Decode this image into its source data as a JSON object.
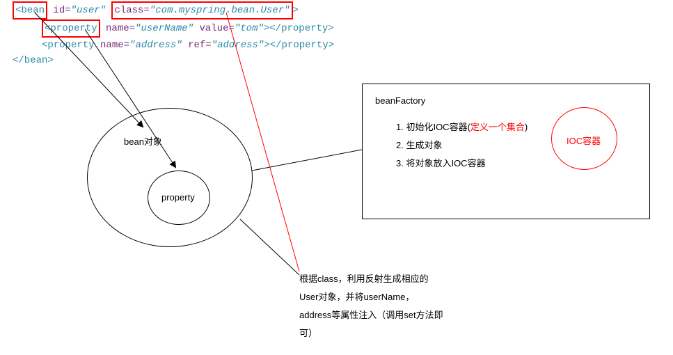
{
  "code": {
    "line1": {
      "open": "<bean",
      "attr_id": " id=",
      "val_id": "\"user\"",
      "attr_class": " class=",
      "val_class": "\"com.myspring.bean.User\"",
      "close": ">"
    },
    "line2": {
      "open": "<property",
      "attr_name": " name=",
      "val_name": "\"userName\"",
      "attr_value": " value=",
      "val_value": "\"tom\"",
      "close": ">",
      "end": "</property>"
    },
    "line3": {
      "open": "<property",
      "attr_name": " name=",
      "val_name": "\"address\"",
      "attr_ref": " ref=",
      "val_ref": "\"address\"",
      "close": ">",
      "end": "</property>"
    },
    "line4": "</bean>"
  },
  "bean_circle_label": "bean对象",
  "property_circle_label": "property",
  "factory": {
    "title": "beanFactory",
    "item1_pre": "1. 初始化IOC容器(",
    "item1_red": "定义一个集合",
    "item1_post": ")",
    "item2": "2. 生成对象",
    "item3": "3. 将对象放入IOC容器",
    "ioc_label": "IOC容器"
  },
  "description": "根据class，利用反射生成相应的User对象，并将userName，address等属性注入（调用set方法即可）"
}
